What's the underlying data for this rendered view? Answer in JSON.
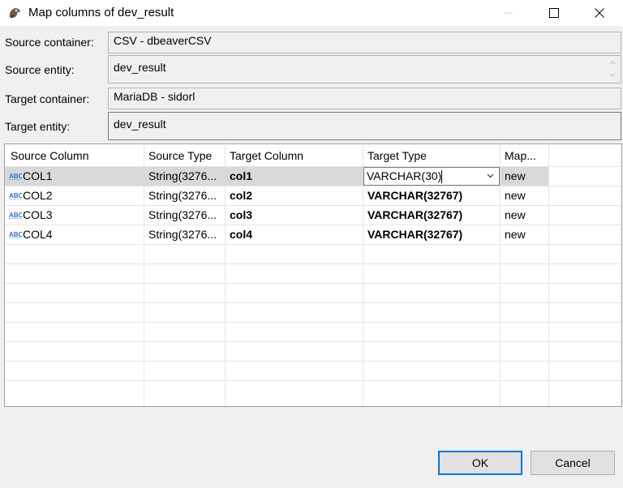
{
  "window": {
    "title": "Map columns of dev_result"
  },
  "fields": {
    "source_container": {
      "label": "Source container:",
      "value": "CSV - dbeaverCSV"
    },
    "source_entity": {
      "label": "Source entity:",
      "value": "dev_result"
    },
    "target_container": {
      "label": "Target container:",
      "value": "MariaDB - sidorl"
    },
    "target_entity": {
      "label": "Target entity:",
      "value": "dev_result"
    }
  },
  "table": {
    "headers": [
      "Source Column",
      "Source Type",
      "Target Column",
      "Target Type",
      "Map..."
    ],
    "rows": [
      {
        "source_column": "COL1",
        "source_type": "String(3276...",
        "target_column": "col1",
        "target_type": "VARCHAR(30)",
        "mapping": "new"
      },
      {
        "source_column": "COL2",
        "source_type": "String(3276...",
        "target_column": "col2",
        "target_type": "VARCHAR(32767)",
        "mapping": "new"
      },
      {
        "source_column": "COL3",
        "source_type": "String(3276...",
        "target_column": "col3",
        "target_type": "VARCHAR(32767)",
        "mapping": "new"
      },
      {
        "source_column": "COL4",
        "source_type": "String(3276...",
        "target_column": "col4",
        "target_type": "VARCHAR(32767)",
        "mapping": "new"
      }
    ],
    "column_icon": "abc-text-icon"
  },
  "buttons": {
    "ok": "OK",
    "cancel": "Cancel"
  },
  "colors": {
    "selected_row": "#d9d9d9",
    "default_button_border": "#0078d7",
    "abc_icon": "#2b74c7"
  }
}
